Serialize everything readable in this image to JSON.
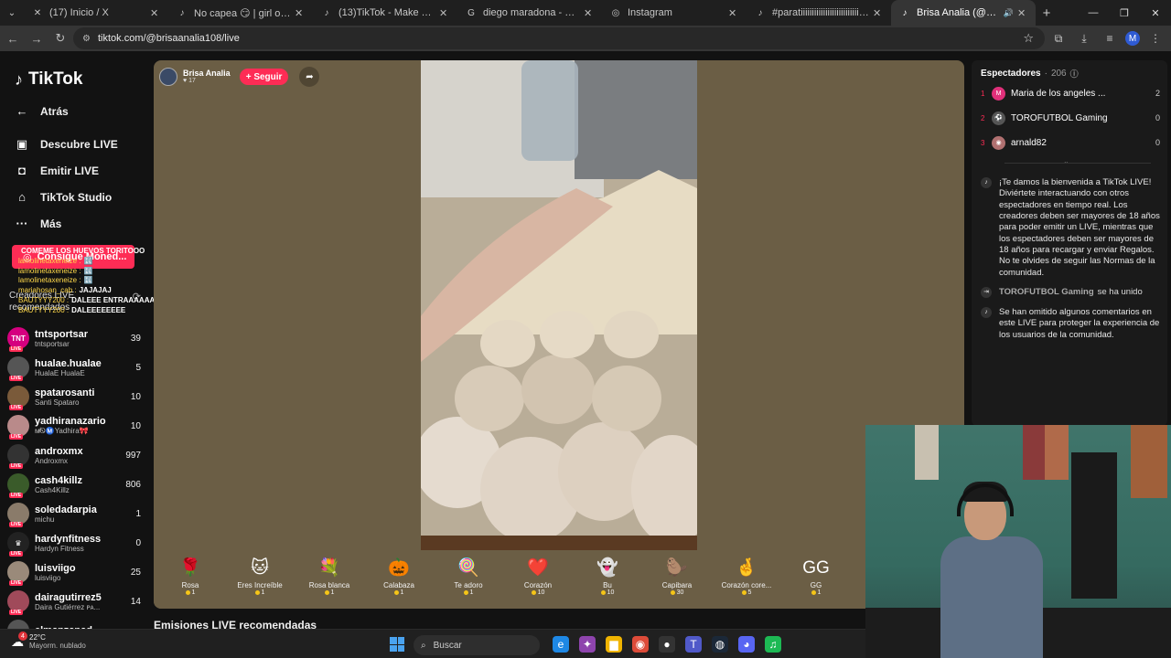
{
  "browser": {
    "tabs": [
      {
        "title": "(17) Inicio / X",
        "icon": "x-logo-icon",
        "glyph": "✕",
        "active": false
      },
      {
        "title": "No capea 😏 | girl of nox | TikTok",
        "icon": "tiktok-icon",
        "glyph": "♪",
        "active": false
      },
      {
        "title": "(13)TikTok - Make Your Day",
        "icon": "tiktok-icon",
        "glyph": "♪",
        "active": false
      },
      {
        "title": "diego maradona - Buscar con Google",
        "icon": "google-icon",
        "glyph": "G",
        "active": false
      },
      {
        "title": "Instagram",
        "icon": "instagram-icon",
        "glyph": "◎",
        "active": false
      },
      {
        "title": "#paratiiiiiiiiiiiiiiiiiiiiiiiiii #queso",
        "icon": "tiktok-icon",
        "glyph": "♪",
        "active": false
      },
      {
        "title": "Brisa Analia (@brisaanalia108)",
        "icon": "tiktok-icon",
        "glyph": "♪",
        "active": true
      }
    ],
    "url": "tiktok.com/@brisaanalia108/live",
    "profile_initial": "M"
  },
  "sidebar": {
    "logo": "TikTok",
    "back_label": "Atrás",
    "nav": [
      {
        "label": "Descubre LIVE",
        "icon": "live-tv-icon",
        "glyph": "▣"
      },
      {
        "label": "Emitir LIVE",
        "icon": "camera-icon",
        "glyph": "◘"
      },
      {
        "label": "TikTok Studio",
        "icon": "home-icon",
        "glyph": "⌂"
      },
      {
        "label": "Más",
        "icon": "more-icon",
        "glyph": "···"
      }
    ],
    "coins_label": "Consigue Moned...",
    "recommended_header": "Creadores LIVE recomendados",
    "recommended": [
      {
        "name": "tntsportsar",
        "sub": "tntsportsar",
        "count": "39",
        "color": "#d5007f",
        "avatar_text": "TNT"
      },
      {
        "name": "hualae.hualae",
        "sub": "HualaE HualaE",
        "count": "5",
        "color": "#555",
        "avatar_text": ""
      },
      {
        "name": "spatarosanti",
        "sub": "Santi Spataro",
        "count": "10",
        "color": "#7a5a3a",
        "avatar_text": ""
      },
      {
        "name": "yadhiranazario",
        "sub": "м̸ᏫⓂ️Yadhira🎀",
        "count": "10",
        "color": "#b98a8a",
        "avatar_text": ""
      },
      {
        "name": "androxmx",
        "sub": "Androxmx",
        "count": "997",
        "color": "#333",
        "avatar_text": ""
      },
      {
        "name": "cash4killz",
        "sub": "Cash4Killz",
        "count": "806",
        "color": "#3a5b2a",
        "avatar_text": ""
      },
      {
        "name": "soledadarpia",
        "sub": "michu",
        "count": "1",
        "color": "#8a7b6a",
        "avatar_text": ""
      },
      {
        "name": "hardynfitness",
        "sub": "Hardyn Fitness",
        "count": "0",
        "color": "#222",
        "avatar_text": "♛"
      },
      {
        "name": "luisviigo",
        "sub": "luisviigo",
        "count": "25",
        "color": "#9a8a7a",
        "avatar_text": ""
      },
      {
        "name": "dairagutirrez5",
        "sub": "Daira Gutiérrez ᴘᴀ...",
        "count": "14",
        "color": "#a04a5a",
        "avatar_text": ""
      },
      {
        "name": "elmanzanad...",
        "sub": "",
        "count": "",
        "color": "#555",
        "avatar_text": ""
      }
    ]
  },
  "chat_overlay": [
    {
      "user": "",
      "msg": "COMEME LOS HUEVOS TORITOOO"
    },
    {
      "user": "lamolinetaxeneize :",
      "msg": "🔣"
    },
    {
      "user": "lamolinetaxeneize :",
      "msg": "🔣"
    },
    {
      "user": "lamolinetaxeneize :",
      "msg": "🔣"
    },
    {
      "user": "mariahosan_cab :",
      "msg": "JAJAJAJ"
    },
    {
      "user": "BAUTYYY200 :",
      "msg": "DALEEE ENTRAAAAAA"
    },
    {
      "user": "BAUTYYY200 :",
      "msg": "DALEEEEEEEE"
    }
  ],
  "live": {
    "host_name": "Brisa Analia",
    "host_likes": "♥ 17",
    "follow_label": "+ Seguir",
    "gifts": [
      {
        "name": "Rosa",
        "price": "1",
        "glyph": "🌹"
      },
      {
        "name": "Eres Increíble",
        "price": "1",
        "glyph": "🐱"
      },
      {
        "name": "Rosa blanca",
        "price": "1",
        "glyph": "💐"
      },
      {
        "name": "Calabaza",
        "price": "1",
        "glyph": "🎃"
      },
      {
        "name": "Te adoro",
        "price": "1",
        "glyph": "🍭"
      },
      {
        "name": "Corazón",
        "price": "10",
        "glyph": "❤️"
      },
      {
        "name": "Bu",
        "price": "10",
        "glyph": "👻"
      },
      {
        "name": "Capibara",
        "price": "30",
        "glyph": "🦫"
      },
      {
        "name": "Corazón core...",
        "price": "5",
        "glyph": "🤞"
      },
      {
        "name": "GG",
        "price": "1",
        "glyph": "GG"
      }
    ],
    "recs_title": "Emisiones LIVE recomendadas"
  },
  "chat_panel": {
    "viewers_label": "Espectadores",
    "viewers_count": "206",
    "top_viewers": [
      {
        "rank": "1",
        "name": "Maria de los angeles ...",
        "score": "2",
        "color": "#e0307a",
        "initial": "M"
      },
      {
        "rank": "2",
        "name": "TOROFUTBOL Gaming",
        "score": "0",
        "color": "#555",
        "initial": "⚽"
      },
      {
        "rank": "3",
        "name": "arnald82",
        "score": "0",
        "color": "#b07070",
        "initial": "◉"
      }
    ],
    "welcome_msg": "¡Te damos la bienvenida a TikTok LIVE! Diviértete interactuando con otros espectadores en tiempo real. Los creadores deben ser mayores de 18 años para poder emitir un LIVE, mientras que los espectadores deben ser mayores de 18 años para recargar y enviar Regalos. No te olvides de seguir las Normas de la comunidad.",
    "join_user": "TOROFUTBOL Gaming",
    "join_verb": "se ha unido",
    "omitted_msg": "Se han omitido algunos comentarios en este LIVE para proteger la experiencia de los usuarios de la comunidad."
  },
  "taskbar": {
    "notif_count": "4",
    "temp": "22°C",
    "weather": "Mayorm. nublado",
    "search_placeholder": "Buscar",
    "apps": [
      "edge-icon",
      "copilot-icon",
      "file-explorer-icon",
      "chrome-icon",
      "obs-icon",
      "teams-icon",
      "steam-icon",
      "discord-icon",
      "spotify-icon"
    ]
  }
}
